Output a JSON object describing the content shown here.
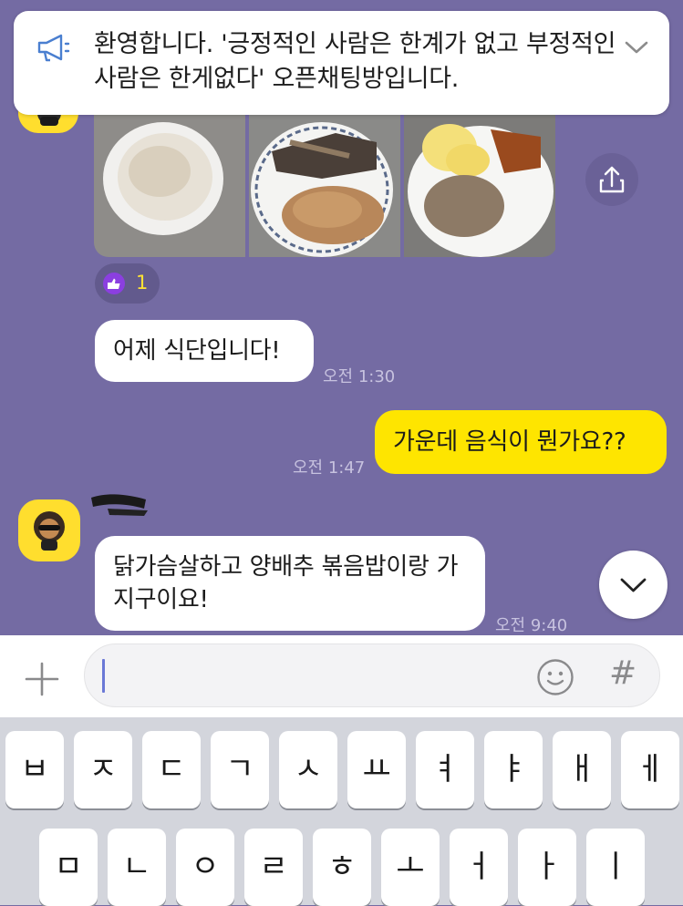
{
  "notice": {
    "text": "환영합니다. '긍정적인 사람은 한계가 없고 부정적인 사람은 한게없다' 오픈채팅방입니다."
  },
  "reaction": {
    "count": "1"
  },
  "messages": [
    {
      "text": "어제 식단입니다!",
      "time": "오전 1:30"
    },
    {
      "text": "가운데 음식이 뭔가요??",
      "time": "오전 1:47"
    },
    {
      "text": "닭가슴살하고 양배추 볶음밥이랑 가지구이요!",
      "time": "오전 9:40"
    }
  ],
  "input": {
    "hash_label": "#"
  },
  "keyboard": {
    "row1": [
      "ㅂ",
      "ㅈ",
      "ㄷ",
      "ㄱ",
      "ㅅ",
      "ㅛ",
      "ㅕ",
      "ㅑ",
      "ㅐ",
      "ㅔ"
    ],
    "row2": [
      "ㅁ",
      "ㄴ",
      "ㅇ",
      "ㄹ",
      "ㅎ",
      "ㅗ",
      "ㅓ",
      "ㅏ",
      "ㅣ"
    ]
  },
  "colors": {
    "chat_bg": "#746ba3",
    "my_bubble": "#fee500",
    "accent": "#ffe234"
  }
}
